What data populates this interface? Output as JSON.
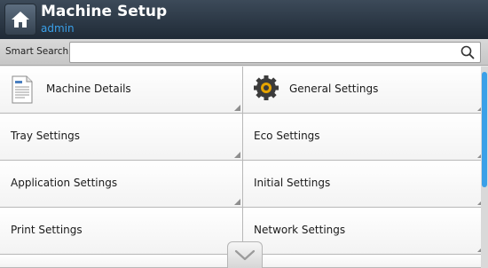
{
  "header": {
    "title": "Machine Setup",
    "user": "admin",
    "home_icon": "home-icon"
  },
  "search": {
    "label": "Smart Search",
    "value": "",
    "placeholder": "",
    "icon": "search-icon"
  },
  "menu": {
    "items": [
      {
        "label": "Machine Details",
        "icon": "document-icon"
      },
      {
        "label": "General Settings",
        "icon": "gear-icon"
      },
      {
        "label": "Tray Settings"
      },
      {
        "label": "Eco Settings"
      },
      {
        "label": "Application Settings"
      },
      {
        "label": "Initial Settings"
      },
      {
        "label": "Print Settings"
      },
      {
        "label": "Network Settings"
      }
    ]
  },
  "colors": {
    "header": "#2b3846",
    "accent": "#3aa0e8",
    "scroll_thumb": "#3aa0e8"
  },
  "footer": {
    "more_icon": "chevron-down-icon"
  }
}
